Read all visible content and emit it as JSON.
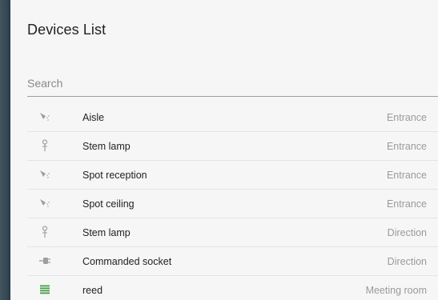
{
  "panel": {
    "title": "Devices List"
  },
  "search": {
    "placeholder": "Search",
    "value": ""
  },
  "devices": [
    {
      "icon": "spotlight-icon",
      "name": "Aisle",
      "room": "Entrance"
    },
    {
      "icon": "stem-lamp-icon",
      "name": "Stem lamp",
      "room": "Entrance"
    },
    {
      "icon": "spotlight-icon",
      "name": "Spot reception",
      "room": "Entrance"
    },
    {
      "icon": "spotlight-icon",
      "name": "Spot ceiling",
      "room": "Entrance"
    },
    {
      "icon": "stem-lamp-icon",
      "name": "Stem lamp",
      "room": "Direction"
    },
    {
      "icon": "plug-icon",
      "name": "Commanded socket",
      "room": "Direction"
    },
    {
      "icon": "reed-sensor-icon",
      "name": "reed",
      "room": "Meeting room"
    }
  ],
  "colors": {
    "icon_gray": "#9e9e9e",
    "reed_green": "#43a047"
  }
}
